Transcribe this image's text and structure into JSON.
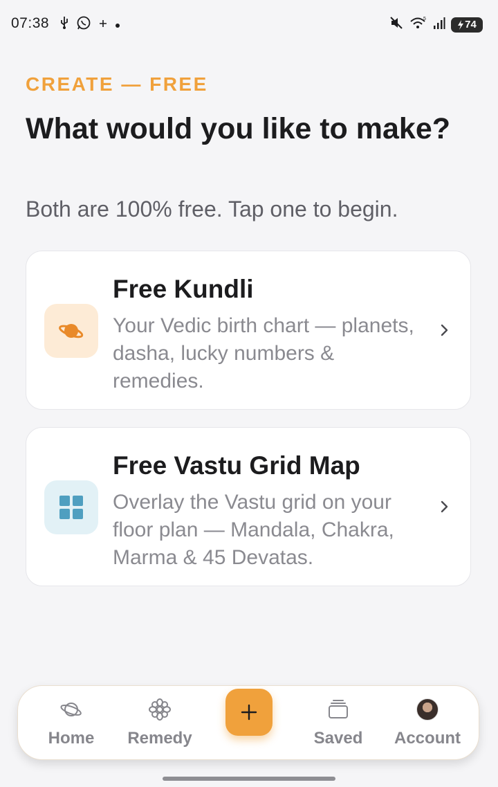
{
  "status_bar": {
    "time": "07:38",
    "battery": "74"
  },
  "header": {
    "eyebrow": "CREATE — FREE",
    "title": "What would you like to make?",
    "subtitle": "Both are 100% free. Tap one to begin."
  },
  "cards": [
    {
      "title": "Free Kundli",
      "description": "Your Vedic birth chart — planets, dasha, lucky numbers & remedies.",
      "icon": "planet-icon",
      "icon_color": "#e98a2a",
      "icon_bg": "#fdebd6"
    },
    {
      "title": "Free Vastu Grid Map",
      "description": "Overlay the Vastu grid on your floor plan — Mandala, Chakra, Marma & 45 Devatas.",
      "icon": "grid-icon",
      "icon_color": "#4f9fc0",
      "icon_bg": "#e2f1f6"
    }
  ],
  "bottom_nav": {
    "items": [
      {
        "label": "Home",
        "icon": "planet-icon"
      },
      {
        "label": "Remedy",
        "icon": "flower-icon"
      },
      {
        "label": "Saved",
        "icon": "stack-icon"
      },
      {
        "label": "Account",
        "icon": "avatar"
      }
    ],
    "add_button_icon": "plus-icon"
  },
  "colors": {
    "accent": "#f0a13c",
    "text_primary": "#1c1c1e",
    "text_secondary": "#8a8a90",
    "background": "#f5f5f7"
  }
}
